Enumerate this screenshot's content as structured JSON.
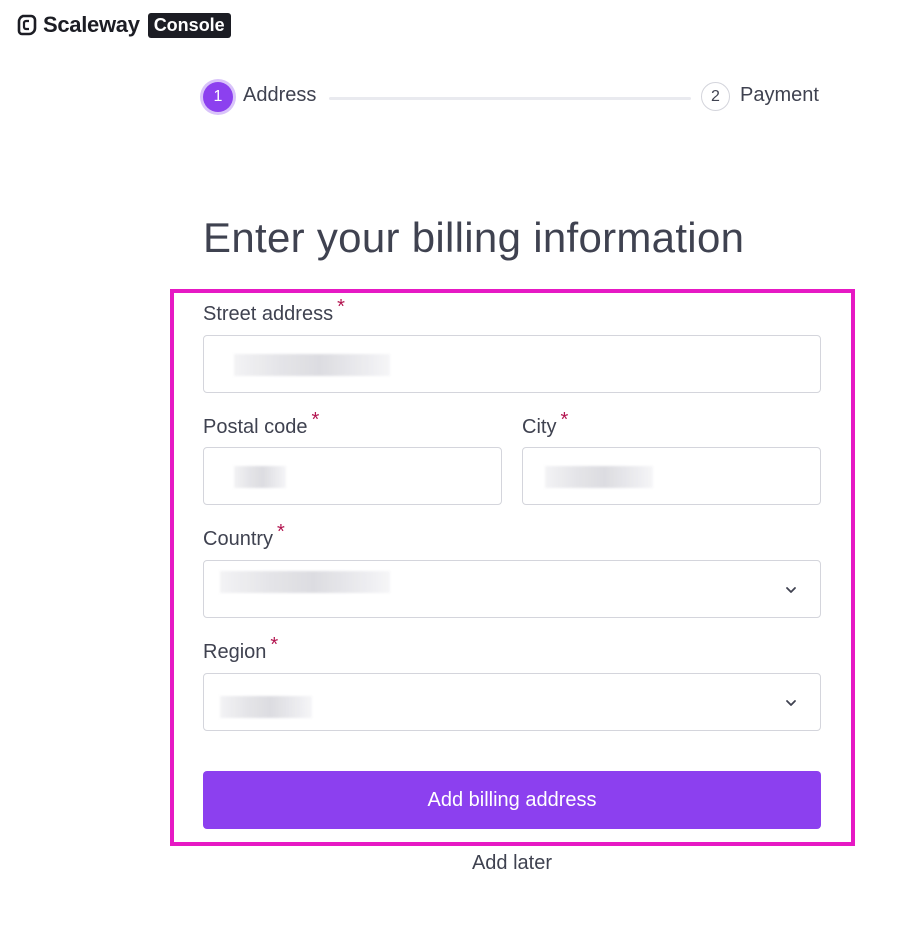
{
  "header": {
    "brand": "Scaleway",
    "badge": "Console"
  },
  "stepper": {
    "steps": [
      {
        "number": "1",
        "label": "Address",
        "state": "active"
      },
      {
        "number": "2",
        "label": "Payment",
        "state": "inactive"
      }
    ]
  },
  "page": {
    "title": "Enter your billing information"
  },
  "form": {
    "required_mark": "*",
    "street": {
      "label": "Street address",
      "value": ""
    },
    "postal": {
      "label": "Postal code",
      "value": ""
    },
    "city": {
      "label": "City",
      "value": ""
    },
    "country": {
      "label": "Country",
      "value": ""
    },
    "region": {
      "label": "Region",
      "value": ""
    },
    "submit_label": "Add billing address",
    "secondary_label": "Add later"
  },
  "colors": {
    "primary": "#8c40ef",
    "highlight_frame": "#e619c4",
    "required": "#b3144f",
    "text": "#3f4250"
  },
  "icons": [
    "scaleway-logo-icon",
    "chevron-down-icon"
  ]
}
